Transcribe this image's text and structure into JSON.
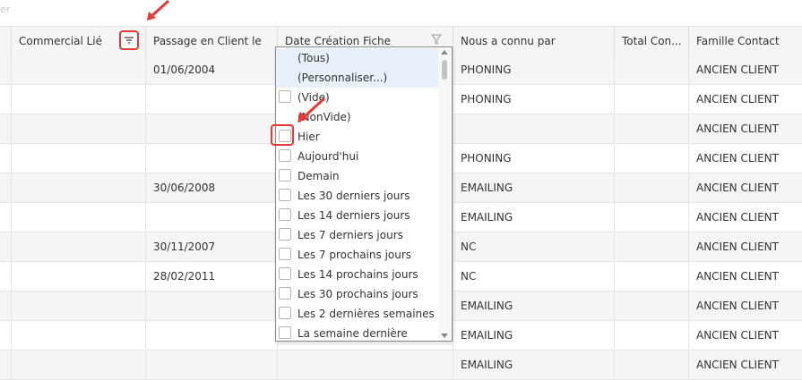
{
  "topbar": {
    "placeholder": "er"
  },
  "columns": [
    {
      "key": "blank",
      "label": ""
    },
    {
      "key": "commercial",
      "label": "Commercial Lié"
    },
    {
      "key": "passage",
      "label": "Passage en Client le"
    },
    {
      "key": "date_creation",
      "label": "Date Création Fiche"
    },
    {
      "key": "connu",
      "label": "Nous a connu par"
    },
    {
      "key": "total",
      "label": "Total Con..."
    },
    {
      "key": "famille",
      "label": "Famille Contact"
    }
  ],
  "rows": [
    {
      "passage": "01/06/2004",
      "connu": "PHONING",
      "famille": "ANCIEN CLIENT"
    },
    {
      "passage": "",
      "connu": "PHONING",
      "famille": "ANCIEN CLIENT"
    },
    {
      "passage": "",
      "connu": "",
      "famille": "ANCIEN CLIENT"
    },
    {
      "passage": "",
      "connu": "PHONING",
      "famille": "ANCIEN CLIENT"
    },
    {
      "passage": "30/06/2008",
      "connu": "EMAILING",
      "famille": "ANCIEN CLIENT"
    },
    {
      "passage": "",
      "connu": "EMAILING",
      "famille": "ANCIEN CLIENT"
    },
    {
      "passage": "30/11/2007",
      "connu": "NC",
      "famille": "ANCIEN CLIENT"
    },
    {
      "passage": "28/02/2011",
      "connu": "NC",
      "famille": "ANCIEN CLIENT"
    },
    {
      "passage": "",
      "connu": "EMAILING",
      "famille": "ANCIEN CLIENT"
    },
    {
      "passage": "",
      "connu": "EMAILING",
      "famille": "ANCIEN CLIENT"
    },
    {
      "passage": "",
      "connu": "EMAILING",
      "famille": "ANCIEN CLIENT"
    }
  ],
  "dropdown": {
    "items": [
      {
        "label": "(Tous)",
        "checkbox": false,
        "selected": true
      },
      {
        "label": "(Personnaliser...)",
        "checkbox": false,
        "selected": true
      },
      {
        "label": "(Vide)",
        "checkbox": true,
        "selected": false
      },
      {
        "label": "(NonVide)",
        "checkbox": false,
        "selected": false
      },
      {
        "label": "Hier",
        "checkbox": true,
        "selected": false
      },
      {
        "label": "Aujourd'hui",
        "checkbox": true,
        "selected": false
      },
      {
        "label": "Demain",
        "checkbox": true,
        "selected": false
      },
      {
        "label": "Les 30 derniers jours",
        "checkbox": true,
        "selected": false
      },
      {
        "label": "Les 14 derniers jours",
        "checkbox": true,
        "selected": false
      },
      {
        "label": "Les 7 derniers jours",
        "checkbox": true,
        "selected": false
      },
      {
        "label": "Les 7 prochains jours",
        "checkbox": true,
        "selected": false
      },
      {
        "label": "Les 14 prochains jours",
        "checkbox": true,
        "selected": false
      },
      {
        "label": "Les 30 prochains jours",
        "checkbox": true,
        "selected": false
      },
      {
        "label": "Les 2 dernières semaines",
        "checkbox": true,
        "selected": false
      },
      {
        "label": "La semaine dernière",
        "checkbox": true,
        "selected": false
      }
    ]
  },
  "icons": {
    "filter_menu": "filter-lines-icon",
    "funnel": "funnel-icon",
    "annotation": "red-arrow"
  },
  "colors": {
    "highlight": "#e53935",
    "selected": "#e6f1fb"
  }
}
